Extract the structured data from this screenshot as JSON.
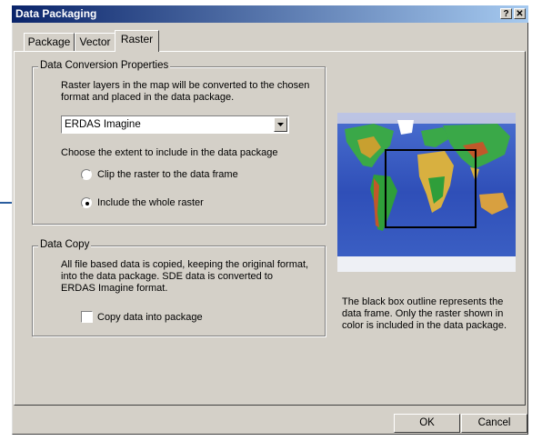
{
  "window": {
    "title": "Data Packaging"
  },
  "titlebar_buttons": {
    "help": "?",
    "close": "✕"
  },
  "tabs": [
    {
      "label": "Package"
    },
    {
      "label": "Vector"
    },
    {
      "label": "Raster"
    }
  ],
  "conversion": {
    "legend": "Data Conversion Properties",
    "description_1": "Raster layers in the map will be converted to the chosen",
    "description_2": "format and placed in the data package.",
    "format_selected": "ERDAS Imagine",
    "extent_prompt": "Choose the extent  to include in the data package",
    "options": [
      {
        "label": "Clip the raster to the data frame",
        "selected": false
      },
      {
        "label": "Include the whole raster",
        "selected": true
      }
    ]
  },
  "copy": {
    "legend": "Data Copy",
    "description_1": "All file based data is copied, keeping the original format,",
    "description_2": "into the data package.  SDE data is converted to",
    "description_3": "ERDAS Imagine format.",
    "checkbox_label": "Copy data into package",
    "checked": false
  },
  "preview": {
    "caption_1": "The black box outline represents the",
    "caption_2": "data frame.  Only the raster shown in",
    "caption_3": "color is included in the data package."
  },
  "buttons": {
    "ok": "OK",
    "cancel": "Cancel"
  },
  "colors": {
    "titlebar_start": "#0a246a",
    "titlebar_end": "#a6caf0",
    "dialog_face": "#d4d0c8",
    "callout": "#2a5d9e"
  }
}
